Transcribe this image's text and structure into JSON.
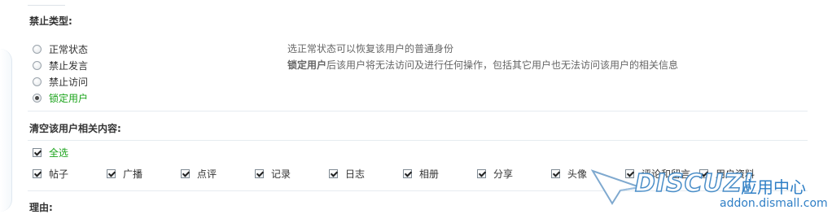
{
  "ban_section": {
    "title": "禁止类型:",
    "options": [
      {
        "label": "正常状态",
        "checked": false
      },
      {
        "label": "禁止发言",
        "checked": false
      },
      {
        "label": "禁止访问",
        "checked": false
      },
      {
        "label": "锁定用户",
        "checked": true
      }
    ],
    "desc_normal": "选正常状态可以恢复该用户的普通身份",
    "desc_lock_bold": "锁定用户",
    "desc_lock_rest": "后该用户将无法访问及进行任何操作，包括其它用户也无法访问该用户的相关信息"
  },
  "clear_section": {
    "title": "清空该用户相关内容:",
    "select_all_label": "全选",
    "items": [
      {
        "label": "帖子",
        "checked": true
      },
      {
        "label": "广播",
        "checked": true
      },
      {
        "label": "点评",
        "checked": true
      },
      {
        "label": "记录",
        "checked": true
      },
      {
        "label": "日志",
        "checked": true
      },
      {
        "label": "相册",
        "checked": true
      },
      {
        "label": "分享",
        "checked": true
      },
      {
        "label": "头像",
        "checked": true
      },
      {
        "label": "评论和留言",
        "checked": true
      },
      {
        "label": "用户资料",
        "checked": true
      }
    ]
  },
  "bottom_section": {
    "title_partial": "理由:"
  },
  "watermark": {
    "brand": "DISCUZ!",
    "cn": "应用中心",
    "url": "addon.dismall.com"
  }
}
